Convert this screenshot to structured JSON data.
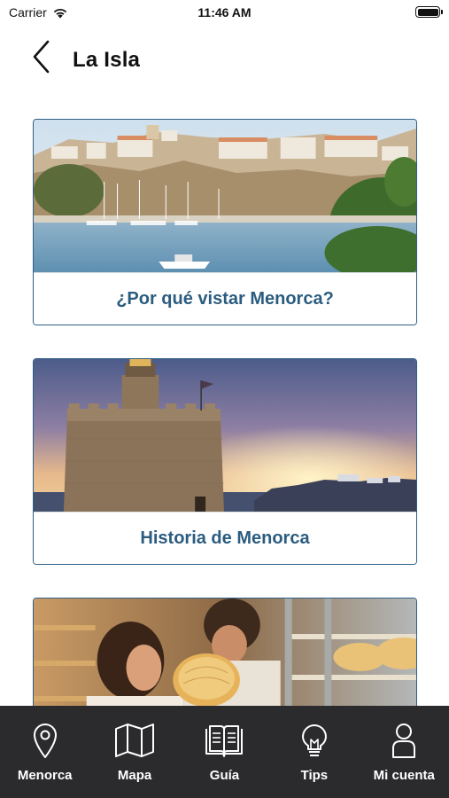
{
  "status": {
    "carrier": "Carrier",
    "time": "11:46 AM"
  },
  "header": {
    "title": "La Isla"
  },
  "cards": [
    {
      "label": "¿Por qué vistar Menorca?",
      "image": "harbor-photo"
    },
    {
      "label": "Historia de Menorca",
      "image": "tower-sunset-photo"
    },
    {
      "label": "",
      "image": "cheese-photo"
    }
  ],
  "tabs": [
    {
      "label": "Menorca",
      "icon": "location-pin-icon"
    },
    {
      "label": "Mapa",
      "icon": "map-icon"
    },
    {
      "label": "Guía",
      "icon": "book-icon"
    },
    {
      "label": "Tips",
      "icon": "lightbulb-icon"
    },
    {
      "label": "Mi cuenta",
      "icon": "user-icon"
    }
  ],
  "colors": {
    "accent": "#2b5c80",
    "card_border": "#2f5f84",
    "tab_bar": "#2b2b2e"
  }
}
